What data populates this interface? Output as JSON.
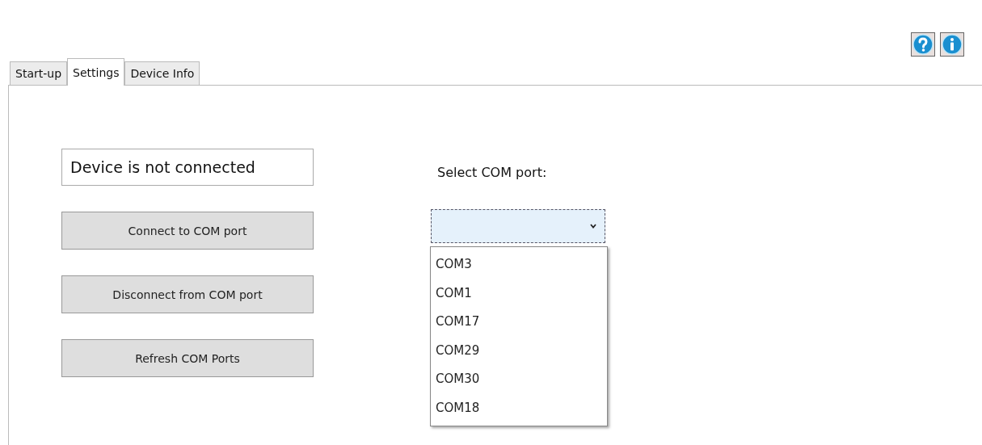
{
  "toolbar": {
    "buttons": [
      {
        "kind": "help"
      },
      {
        "kind": "info"
      }
    ]
  },
  "tabs": [
    {
      "label": "Start-up",
      "selected": false
    },
    {
      "label": "Settings",
      "selected": true
    },
    {
      "label": "Device Info",
      "selected": false
    }
  ],
  "status": {
    "text": "Device is not connected"
  },
  "buttons": [
    "Connect to COM port",
    "Disconnect from COM port",
    "Refresh COM Ports"
  ],
  "port_select": {
    "label": "Select COM port:",
    "expanded": true,
    "options": [
      {
        "label": "COM3"
      },
      {
        "label": "COM1"
      },
      {
        "label": "COM17"
      },
      {
        "label": "COM29"
      },
      {
        "label": "COM30"
      },
      {
        "label": "COM18"
      }
    ]
  }
}
